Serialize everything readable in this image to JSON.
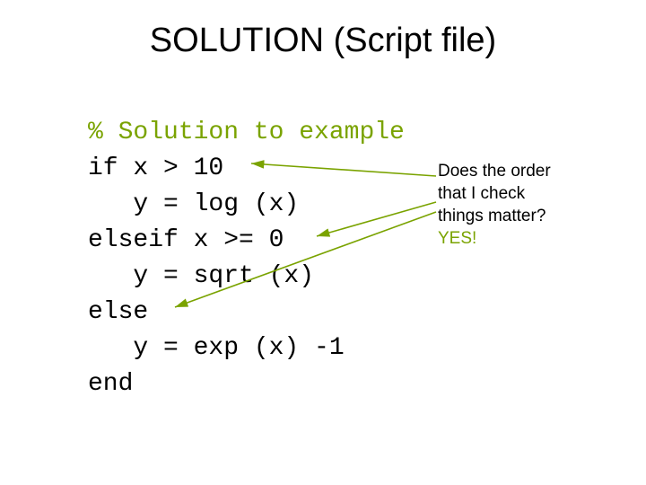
{
  "title": "SOLUTION (Script file)",
  "code": {
    "comment": "% Solution to example",
    "l1": "if x > 10",
    "l2": "   y = log (x)",
    "l3": "elseif x >= 0",
    "l4": "   y = sqrt (x)",
    "l5": "else",
    "l6": "   y = exp (x) -1",
    "l7": "end"
  },
  "annotation": {
    "line1": "Does the order",
    "line2": "that I check",
    "line3": "things matter?",
    "yes": "YES!"
  },
  "colors": {
    "accent": "#7aa300"
  }
}
